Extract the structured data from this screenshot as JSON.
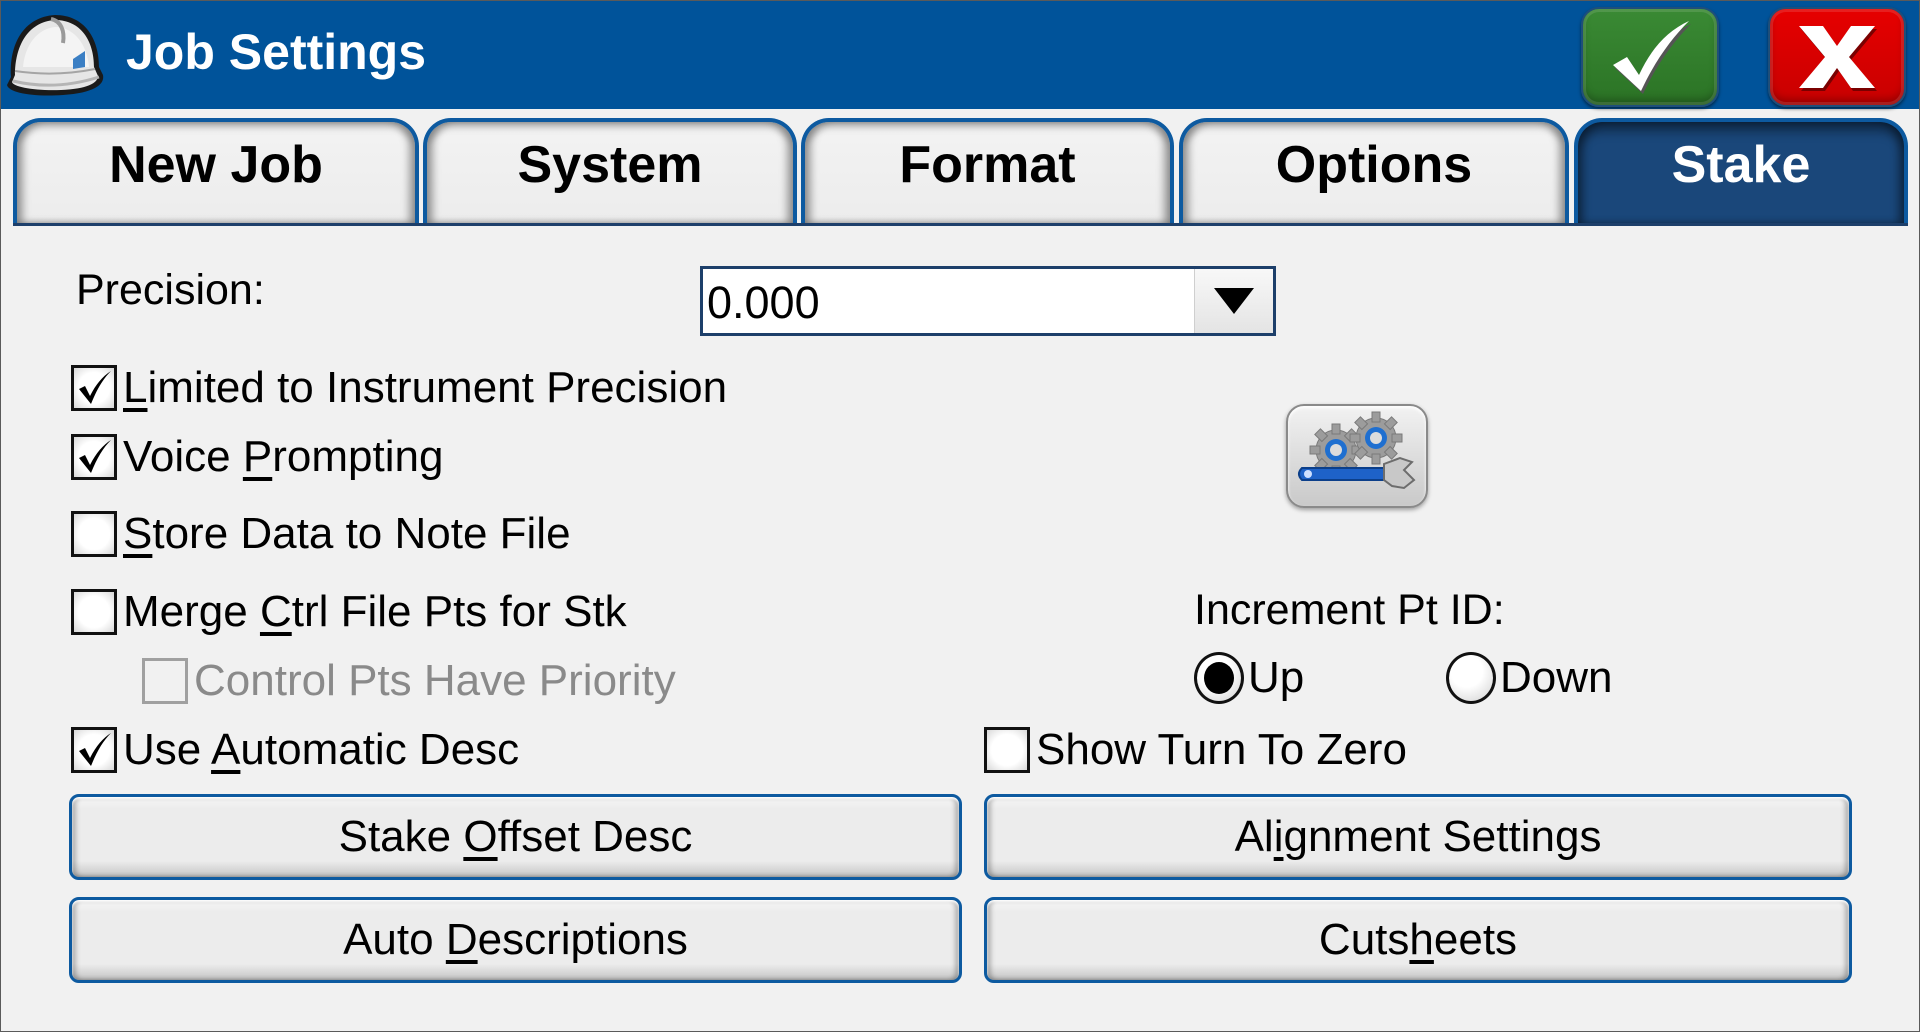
{
  "window": {
    "title": "Job Settings",
    "ok_icon": "checkmark-icon",
    "cancel_icon": "x-icon",
    "title_icon": "hard-hat-icon",
    "colors": {
      "titlebar": "#00539a",
      "ok_button": "#2f7d2a",
      "cancel_button": "#dd0000",
      "active_tab": "#1a477a",
      "tab_border": "#0d5aa0"
    }
  },
  "tabs": [
    {
      "label": "New Job",
      "active": false
    },
    {
      "label": "System",
      "active": false
    },
    {
      "label": "Format",
      "active": false
    },
    {
      "label": "Options",
      "active": false
    },
    {
      "label": "Stake",
      "active": true
    }
  ],
  "precision": {
    "label": "Precision:",
    "value": "0.000",
    "arrow_icon": "triangle-down-icon"
  },
  "checkboxes": {
    "limited": {
      "pre": "",
      "key": "L",
      "post": "imited to Instrument Precision",
      "checked": true,
      "enabled": true
    },
    "voice": {
      "pre": "Voice ",
      "key": "P",
      "post": "rompting",
      "checked": true,
      "enabled": true
    },
    "store": {
      "pre": "",
      "key": "S",
      "post": "tore Data to Note File",
      "checked": false,
      "enabled": true
    },
    "merge": {
      "pre": "Merge ",
      "key": "C",
      "post": "trl File Pts for Stk",
      "checked": false,
      "enabled": true
    },
    "control": {
      "pre": "",
      "key": "",
      "post": "Control Pts Have Priority",
      "checked": false,
      "enabled": false
    },
    "auto_desc": {
      "pre": "Use ",
      "key": "A",
      "post": "utomatic Desc",
      "checked": true,
      "enabled": true
    },
    "turn_zero": {
      "pre": "",
      "key": "",
      "post": "Show Turn To Zero",
      "checked": false,
      "enabled": true
    }
  },
  "settings_button": {
    "icon": "gears-wrench-icon"
  },
  "increment": {
    "label": "Increment Pt ID:",
    "options": [
      {
        "label": "Up",
        "selected": true
      },
      {
        "label": "Down",
        "selected": false
      }
    ]
  },
  "buttons": {
    "stake_offset": {
      "pre": "Stake ",
      "key": "O",
      "post": "ffset Desc"
    },
    "alignment": {
      "pre": "Al",
      "key": "i",
      "post": "gnment Settings"
    },
    "auto_descriptions": {
      "pre": "Auto ",
      "key": "D",
      "post": "escriptions"
    },
    "cutsheets": {
      "pre": "Cuts",
      "key": "h",
      "post": "eets"
    }
  }
}
